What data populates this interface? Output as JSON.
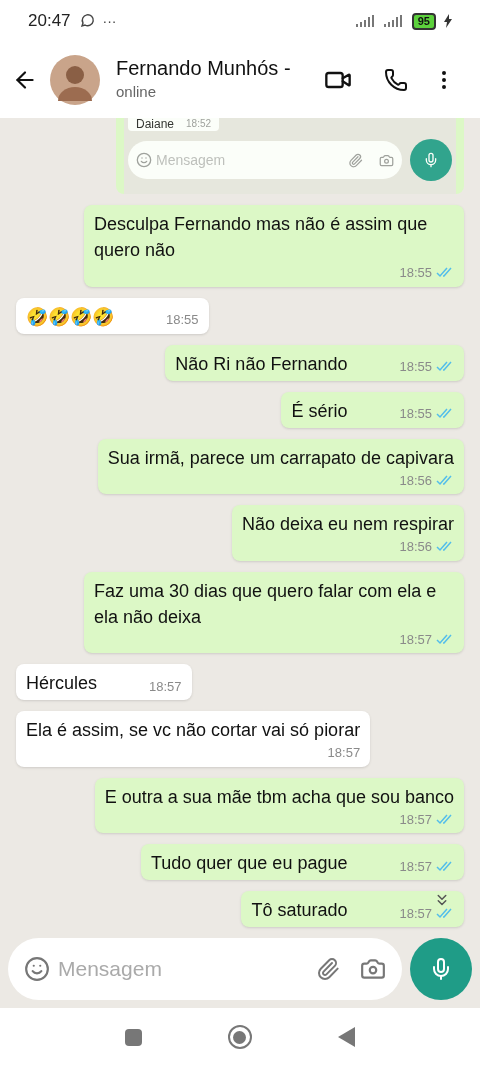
{
  "status_bar": {
    "time": "20:47",
    "more": "···",
    "battery": "95"
  },
  "header": {
    "name": "Fernando Munhós -",
    "status": "online"
  },
  "embedded_screenshot": {
    "sender": "Daiane",
    "time": "18:52",
    "input_placeholder": "Mensagem"
  },
  "messages": [
    {
      "kind": "sent",
      "text": "Desculpa Fernando mas não é assim que quero não",
      "time": "18:55",
      "read": true
    },
    {
      "kind": "received",
      "text": "🤣🤣🤣🤣",
      "time": "18:55"
    },
    {
      "kind": "sent",
      "text": "Não Ri não Fernando",
      "time": "18:55",
      "read": true
    },
    {
      "kind": "sent",
      "text": "É sério",
      "time": "18:55",
      "read": true
    },
    {
      "kind": "sent",
      "text": "Sua irmã, parece um carrapato de capivara",
      "time": "18:56",
      "read": true
    },
    {
      "kind": "sent",
      "text": "Não deixa eu nem respirar",
      "time": "18:56",
      "read": true
    },
    {
      "kind": "sent",
      "text": "Faz uma 30 dias que quero falar com ela e ela não deixa",
      "time": "18:57",
      "read": true
    },
    {
      "kind": "received",
      "text": "Hércules",
      "time": "18:57"
    },
    {
      "kind": "received",
      "text": "Ela é assim, se vc não cortar vai só piorar",
      "time": "18:57"
    },
    {
      "kind": "sent",
      "text": "E outra a sua mãe tbm acha que sou banco",
      "time": "18:57",
      "read": true
    },
    {
      "kind": "sent",
      "text": "Tudo quer que eu pague",
      "time": "18:57",
      "read": true
    },
    {
      "kind": "sent",
      "text": "Tô saturado",
      "time": "18:57",
      "read": true
    }
  ],
  "composer": {
    "placeholder": "Mensagem"
  }
}
